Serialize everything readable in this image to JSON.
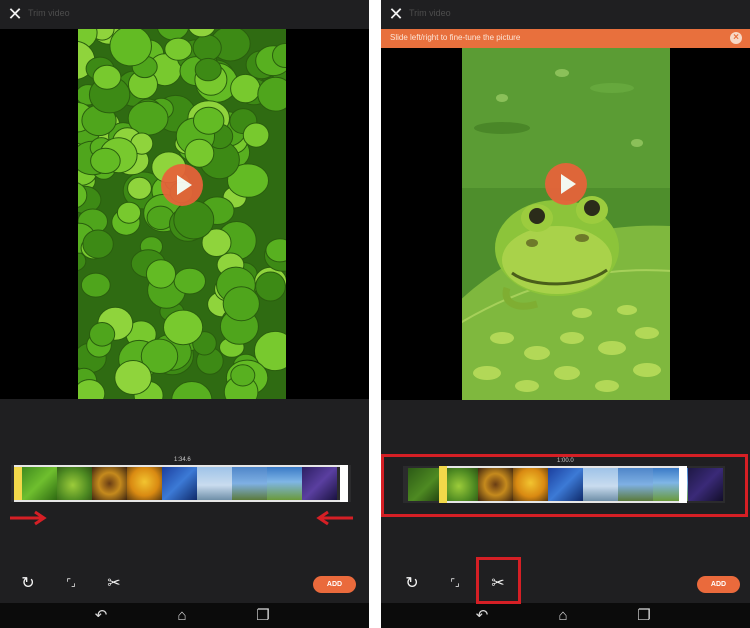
{
  "left_screen": {
    "title": "Trim video",
    "time": "1:34.6",
    "add_label": "ADD"
  },
  "right_screen": {
    "title": "Trim video",
    "tip": "Slide left/right to fine-tune the picture",
    "time": "1:00.0",
    "add_label": "ADD"
  },
  "icons": {
    "close": "close-icon",
    "play": "play-icon",
    "rotate": "rotate-icon",
    "crop": "crop-icon",
    "cut": "scissors-icon",
    "back": "back-icon",
    "home": "home-icon",
    "recent": "recent-apps-icon"
  },
  "colors": {
    "accent": "#e8703d",
    "highlight": "#d51f25",
    "background": "#1f1f21"
  }
}
